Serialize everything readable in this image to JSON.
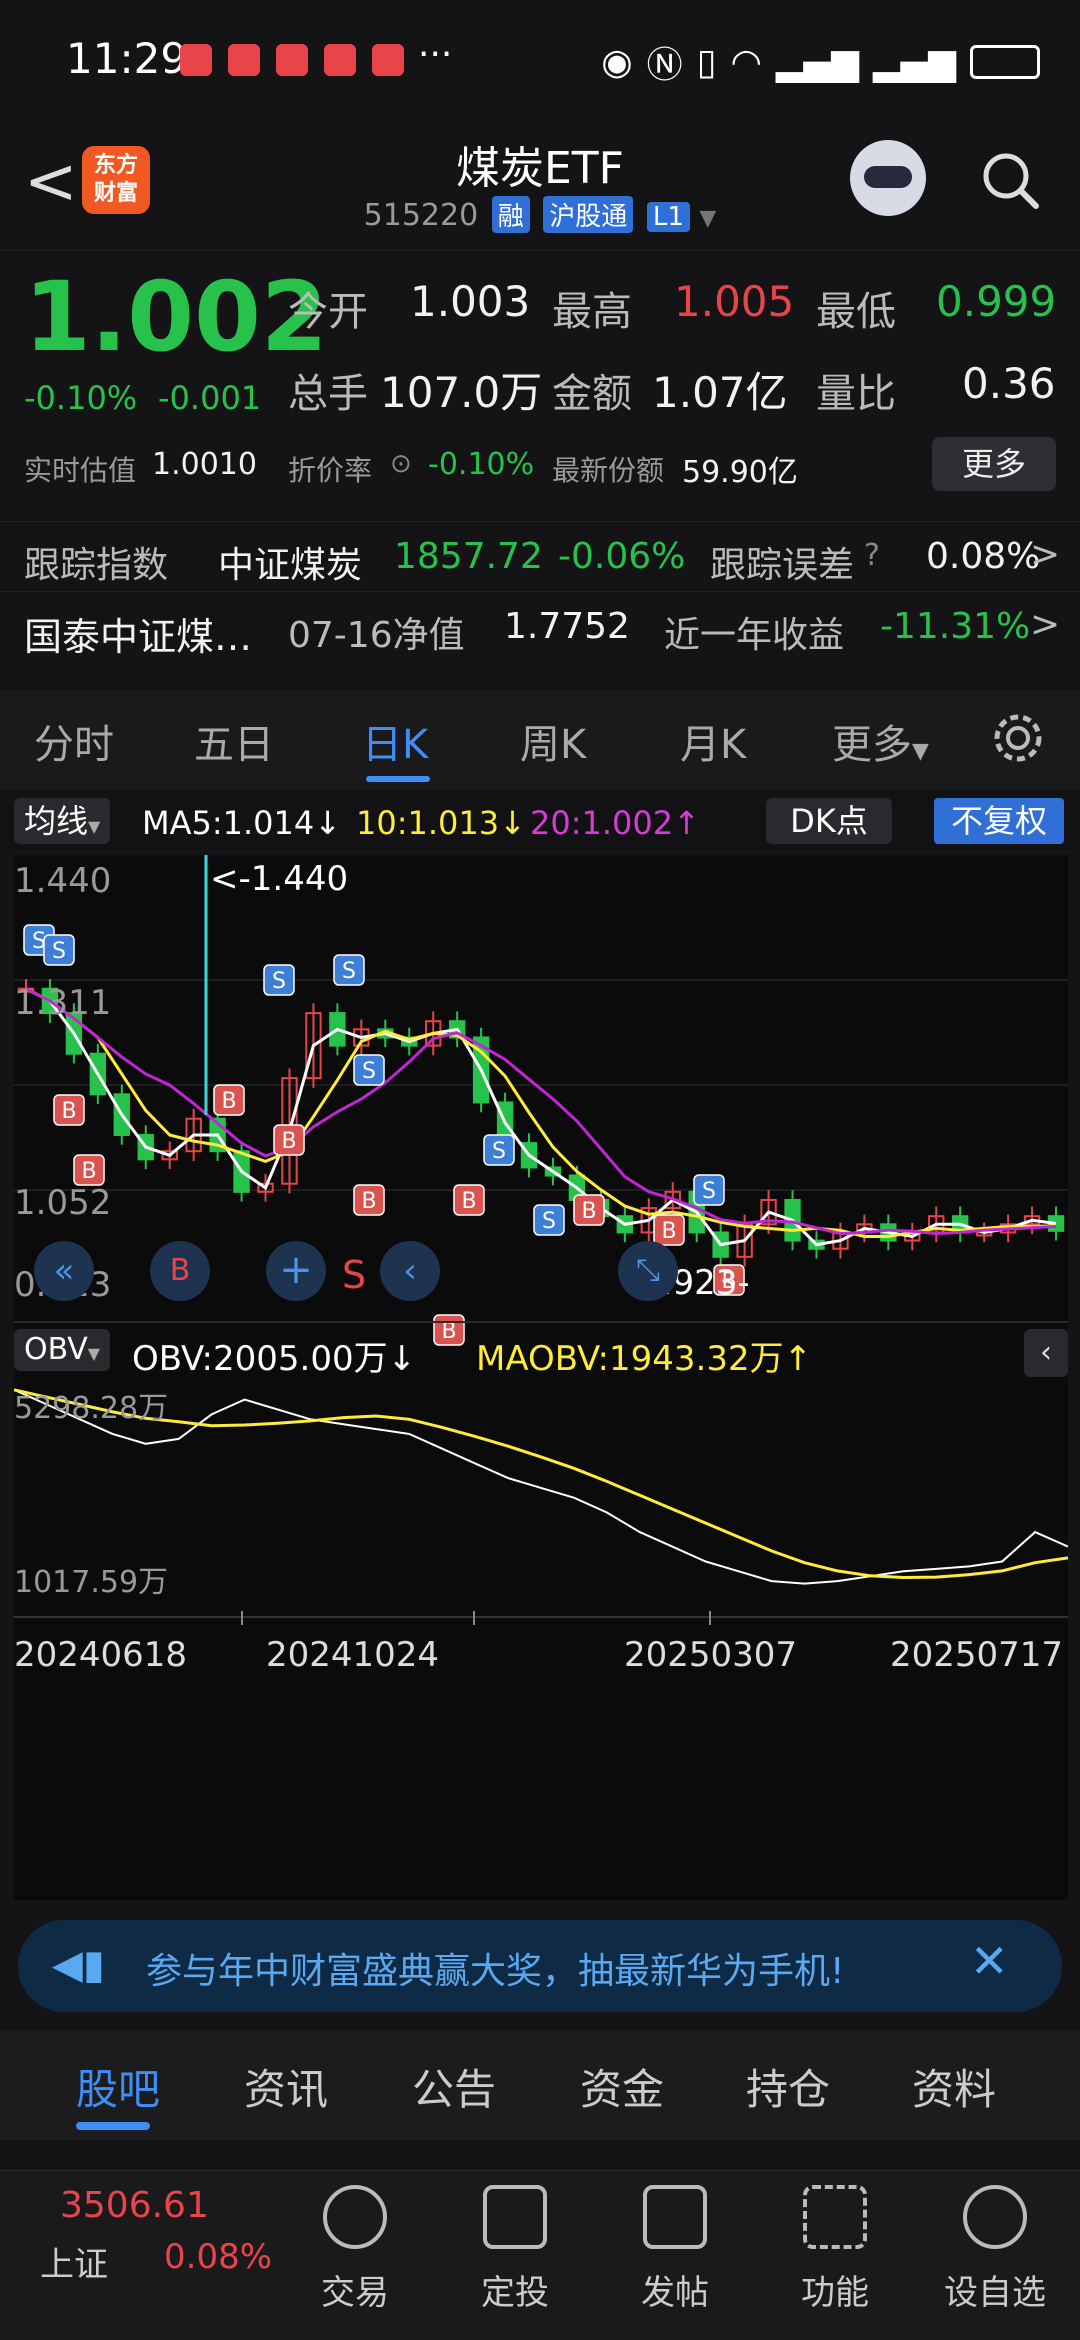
{
  "status": {
    "time": "11:29",
    "more": "···"
  },
  "header": {
    "back": "<",
    "logo": [
      "东方",
      "财富"
    ],
    "title": "煤炭ETF",
    "code": "515220",
    "tags": [
      "融",
      "沪股通",
      "L1"
    ]
  },
  "quote": {
    "price": "1.002",
    "change_pct": "-0.10%",
    "change": "-0.001",
    "open_label": "今开",
    "open": "1.003",
    "high_label": "最高",
    "high": "1.005",
    "low_label": "最低",
    "low": "0.999",
    "vol_label": "总手",
    "vol": "107.0万",
    "amount_label": "金额",
    "amount": "1.07亿",
    "ratio_label": "量比",
    "ratio": "0.36",
    "est_label": "实时估值",
    "est": "1.0010",
    "discount_label": "折价率",
    "discount": "-0.10%",
    "share_label": "最新份额",
    "share": "59.90亿",
    "more_btn": "更多",
    "track_label": "跟踪指数",
    "track_name": "中证煤炭",
    "track_value": "1857.72",
    "track_pct": "-0.06%",
    "err_label": "跟踪误差",
    "err_value": "0.08%",
    "fund_name": "国泰中证煤…",
    "nav_label": "07-16净值",
    "nav": "1.7752",
    "year_label": "近一年收益",
    "year_ret": "-11.31%"
  },
  "ktabs": [
    "分时",
    "五日",
    "日K",
    "周K",
    "月K",
    "更多"
  ],
  "ma": {
    "chip": "均线",
    "ma5": "MA5:1.014↓",
    "ma10": "10:1.013↓",
    "ma20": "20:1.002↑",
    "dk": "DK点",
    "fq": "不复权"
  },
  "chart": {
    "y_labels": [
      "1.440",
      "1.311",
      "1.052",
      "0.923"
    ],
    "max_note": "<-1.440",
    "min_note": "0.923-",
    "obv_chip": "OBV",
    "obv": "OBV:2005.00万↓",
    "maobv": "MAOBV:1943.32万↑",
    "obv_top": "5298.28万",
    "obv_bot": "1017.59万",
    "dates": [
      "20240618",
      "20241024",
      "20250307",
      "20250717"
    ],
    "b_mark": "B",
    "s_mark": "S"
  },
  "chart_data": {
    "type": "candlestick",
    "price_range": [
      0.923,
      1.44
    ],
    "close_approx": [
      1.3,
      1.27,
      1.22,
      1.17,
      1.12,
      1.09,
      1.1,
      1.14,
      1.1,
      1.05,
      1.06,
      1.19,
      1.27,
      1.23,
      1.25,
      1.24,
      1.23,
      1.26,
      1.24,
      1.16,
      1.11,
      1.08,
      1.07,
      1.04,
      1.02,
      1.0,
      1.03,
      1.05,
      1.0,
      0.97,
      1.01,
      1.04,
      0.99,
      0.98,
      1.0,
      1.01,
      0.99,
      1.0,
      1.02,
      1.0,
      1.0,
      1.01,
      1.02,
      1.002
    ],
    "series": [
      {
        "name": "MA5",
        "color": "#ffffff"
      },
      {
        "name": "10",
        "color": "#ffeb3b"
      },
      {
        "name": "20",
        "color": "#c026d3"
      }
    ],
    "obv_range": [
      1017.59,
      5298.28
    ],
    "obv_approx": [
      5200,
      4900,
      4600,
      4300,
      4100,
      4200,
      4700,
      5000,
      4800,
      4600,
      4500,
      4400,
      4300,
      4000,
      3700,
      3400,
      3200,
      3000,
      2700,
      2300,
      2000,
      1700,
      1500,
      1300,
      1250,
      1300,
      1400,
      1500,
      1550,
      1600,
      1700,
      2300,
      2005
    ]
  },
  "banner": {
    "text": "参与年中财富盛典赢大奖，抽最新华为手机!"
  },
  "btabs": [
    "股吧",
    "资讯",
    "公告",
    "资金",
    "持仓",
    "资料"
  ],
  "dock": {
    "index_value": "3506.61",
    "index_name": "上证",
    "index_pct": "0.08%",
    "items": [
      "交易",
      "定投",
      "发帖",
      "功能",
      "设自选"
    ]
  },
  "colors": {
    "up": "#e8454a",
    "down": "#27c24c",
    "accent": "#3d8ef7"
  }
}
